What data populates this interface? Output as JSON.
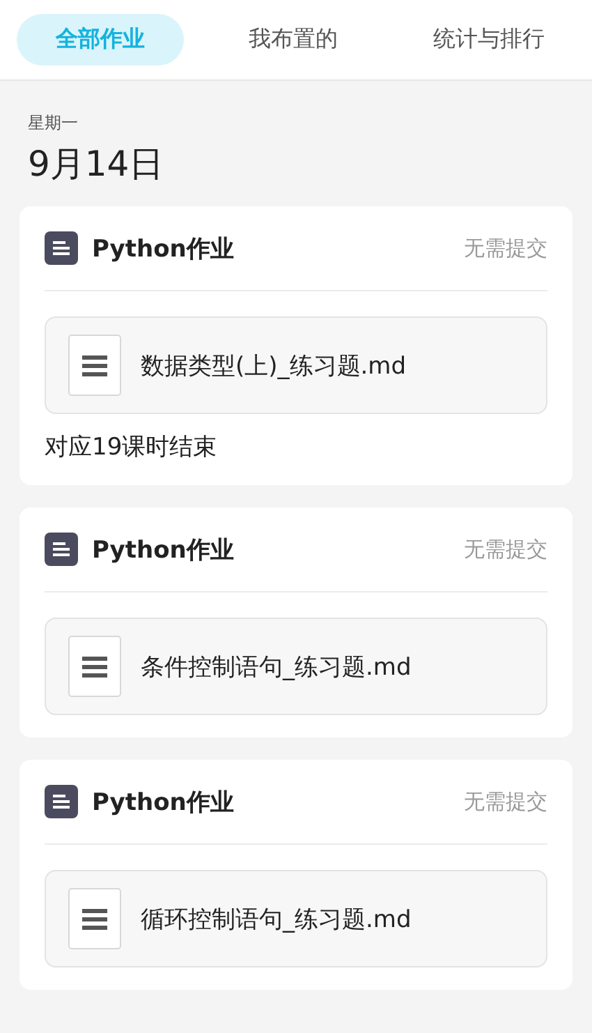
{
  "tabs": [
    {
      "label": "全部作业",
      "selected": true
    },
    {
      "label": "我布置的",
      "selected": false
    },
    {
      "label": "统计与排行",
      "selected": false
    }
  ],
  "day": {
    "weekday": "星期一",
    "date": "9月14日"
  },
  "assignments": [
    {
      "title": "Python作业",
      "status": "无需提交",
      "file": "数据类型(上)_练习题.md",
      "note": "对应19课时结束"
    },
    {
      "title": "Python作业",
      "status": "无需提交",
      "file": "条件控制语句_练习题.md"
    },
    {
      "title": "Python作业",
      "status": "无需提交",
      "file": "循环控制语句_练习题.md"
    }
  ]
}
